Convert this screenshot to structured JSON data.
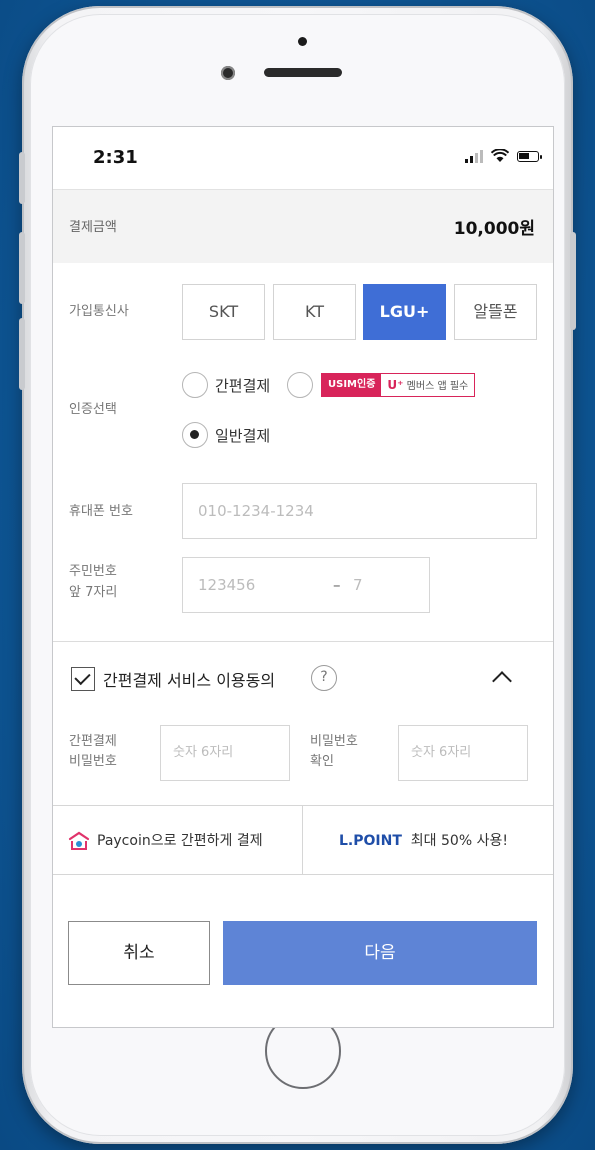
{
  "status": {
    "time": "2:31"
  },
  "amount": {
    "label": "결제금액",
    "value": "10,000원"
  },
  "carrier": {
    "label": "가입통신사",
    "options": [
      "SKT",
      "KT",
      "LGU+",
      "알뜰폰"
    ],
    "selected": "LGU+"
  },
  "auth": {
    "label": "인증선택",
    "options": [
      {
        "label": "간편결제",
        "selected": false
      },
      {
        "label": "",
        "selected": false
      },
      {
        "label": "일반결제",
        "selected": true
      }
    ],
    "usim_badge": {
      "tag": "USIM인증",
      "brand": "U⁺",
      "text": "멤버스 앱 필수"
    }
  },
  "phone": {
    "label": "휴대폰 번호",
    "placeholder": "010-1234-1234"
  },
  "resident": {
    "label_line1": "주민번호",
    "label_line2": "앞 7자리",
    "front_placeholder": "123456",
    "dash": "–",
    "back_placeholder": "7"
  },
  "easy_pay": {
    "agree_label": "간편결제 서비스 이용동의",
    "agreed": true,
    "help": "?",
    "pw_label_line1": "간편결제",
    "pw_label_line2": "비밀번호",
    "pw_placeholder": "숫자 6자리",
    "confirm_label_line1": "비밀번호",
    "confirm_label_line2": "확인",
    "confirm_placeholder": "숫자 6자리"
  },
  "promos": {
    "paycoin": "Paycoin으로 간편하게 결제",
    "lpoint_brand": "L.POINT",
    "lpoint_text": "최대 50% 사용!"
  },
  "actions": {
    "cancel": "취소",
    "next": "다음"
  },
  "colors": {
    "accent": "#3f6ed6",
    "next_button": "#5e84d6",
    "usim": "#d8245a"
  }
}
